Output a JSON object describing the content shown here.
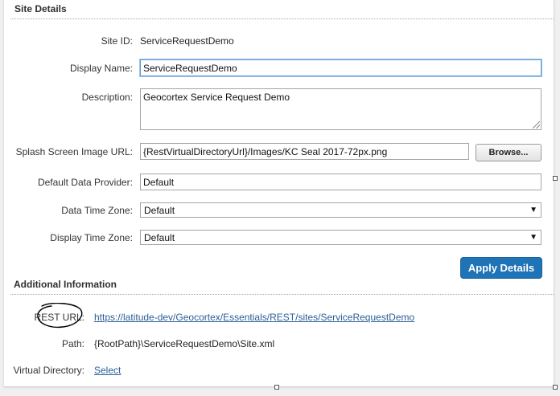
{
  "site_details": {
    "title": "Site Details",
    "site_id": {
      "label": "Site ID:",
      "value": "ServiceRequestDemo"
    },
    "display_name": {
      "label": "Display Name:",
      "value": "ServiceRequestDemo"
    },
    "description": {
      "label": "Description:",
      "value": "Geocortex Service Request Demo"
    },
    "splash_image": {
      "label": "Splash Screen Image URL:",
      "value": "{RestVirtualDirectoryUrl}/Images/KC Seal 2017-72px.png",
      "browse_label": "Browse..."
    },
    "default_provider": {
      "label": "Default Data Provider:",
      "value": "Default"
    },
    "data_time_zone": {
      "label": "Data Time Zone:",
      "value": "Default"
    },
    "display_time_zone": {
      "label": "Display Time Zone:",
      "value": "Default"
    },
    "apply_label": "Apply Details"
  },
  "additional_info": {
    "title": "Additional Information",
    "rest_url": {
      "label": "REST URL:",
      "value": "https://latitude-dev/Geocortex/Essentials/REST/sites/ServiceRequestDemo"
    },
    "path": {
      "label": "Path:",
      "value": "{RootPath}\\ServiceRequestDemo\\Site.xml"
    },
    "virtual_directory": {
      "label": "Virtual Directory:",
      "link": "Select"
    }
  },
  "colors": {
    "accent": "#1f73b7",
    "link": "#2a5d99",
    "focus_border": "#5b9bd5"
  }
}
